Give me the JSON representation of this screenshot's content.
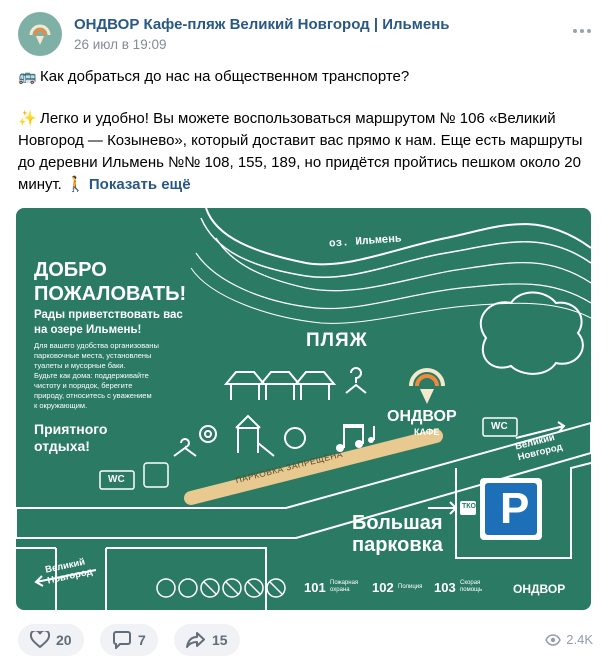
{
  "author": "ОНДВОР Кафе-пляж Великий Новгород | Ильмень",
  "date": "26 июл в 19:09",
  "post": {
    "line1_emoji": "🚌",
    "line1": "Как добраться до нас на общественном транспорте?",
    "line2_emoji": "✨",
    "line2": "Легко и удобно! Вы можете воспользоваться маршрутом № 106 «Великий Новгород — Козынево», который доставит вас прямо к нам. Еще есть маршруты до деревни Ильмень №№ 108, 155, 189, но придётся пройтись пешком около 20 минут.",
    "walk_emoji": "🚶",
    "show_more": "Показать ещё"
  },
  "poster": {
    "lake": "оз. Ильмень",
    "welcome": "ДОБРО ПОЖАЛОВАТЬ!",
    "welcome_line1": "ДОБРО",
    "welcome_line2": "ПОЖАЛОВАТЬ!",
    "glad1": "Рады приветствовать вас",
    "glad2": "на озере Ильмень!",
    "info1": "Для вашего удобства организованы",
    "info2": "парковочные места, установлены",
    "info3": "туалеты и мусорные баки.",
    "info4": "Будьте как дома: поддерживайте",
    "info5": "чистоту и порядок, берегите",
    "info6": "природу, относитесь с уважением",
    "info7": "к окружающим.",
    "rest1": "Приятного",
    "rest2": "отдыха!",
    "beach": "ПЛЯЖ",
    "brand": "ОНДВОР",
    "cafe": "КАФЕ",
    "wc": "WC",
    "parking_forbidden": "ПАРКОВКА ЗАПРЕЩЕНА",
    "road_top_1": "Великий",
    "road_top_2": "Новгород",
    "road_left_1": "Великий",
    "road_left_2": "Новгород",
    "big_parking_1": "Большая",
    "big_parking_2": "парковка",
    "parking_letter": "P",
    "tko": "ТКО",
    "phone1_num": "101",
    "phone1_label1": "Пожарная",
    "phone1_label2": "охрана",
    "phone2_num": "102",
    "phone2_label": "Полиция",
    "phone3_num": "103",
    "phone3_label1": "Скорая",
    "phone3_label2": "помощь",
    "footer_brand": "ОНДВОР"
  },
  "stats": {
    "likes": "20",
    "comments": "7",
    "shares": "15",
    "views": "2.4K"
  },
  "colors": {
    "poster_bg": "#2b7a64",
    "road": "#3f8e77",
    "path": "#e8c98f",
    "link": "#2a5885",
    "parking_sign": "#1d6fb8"
  }
}
